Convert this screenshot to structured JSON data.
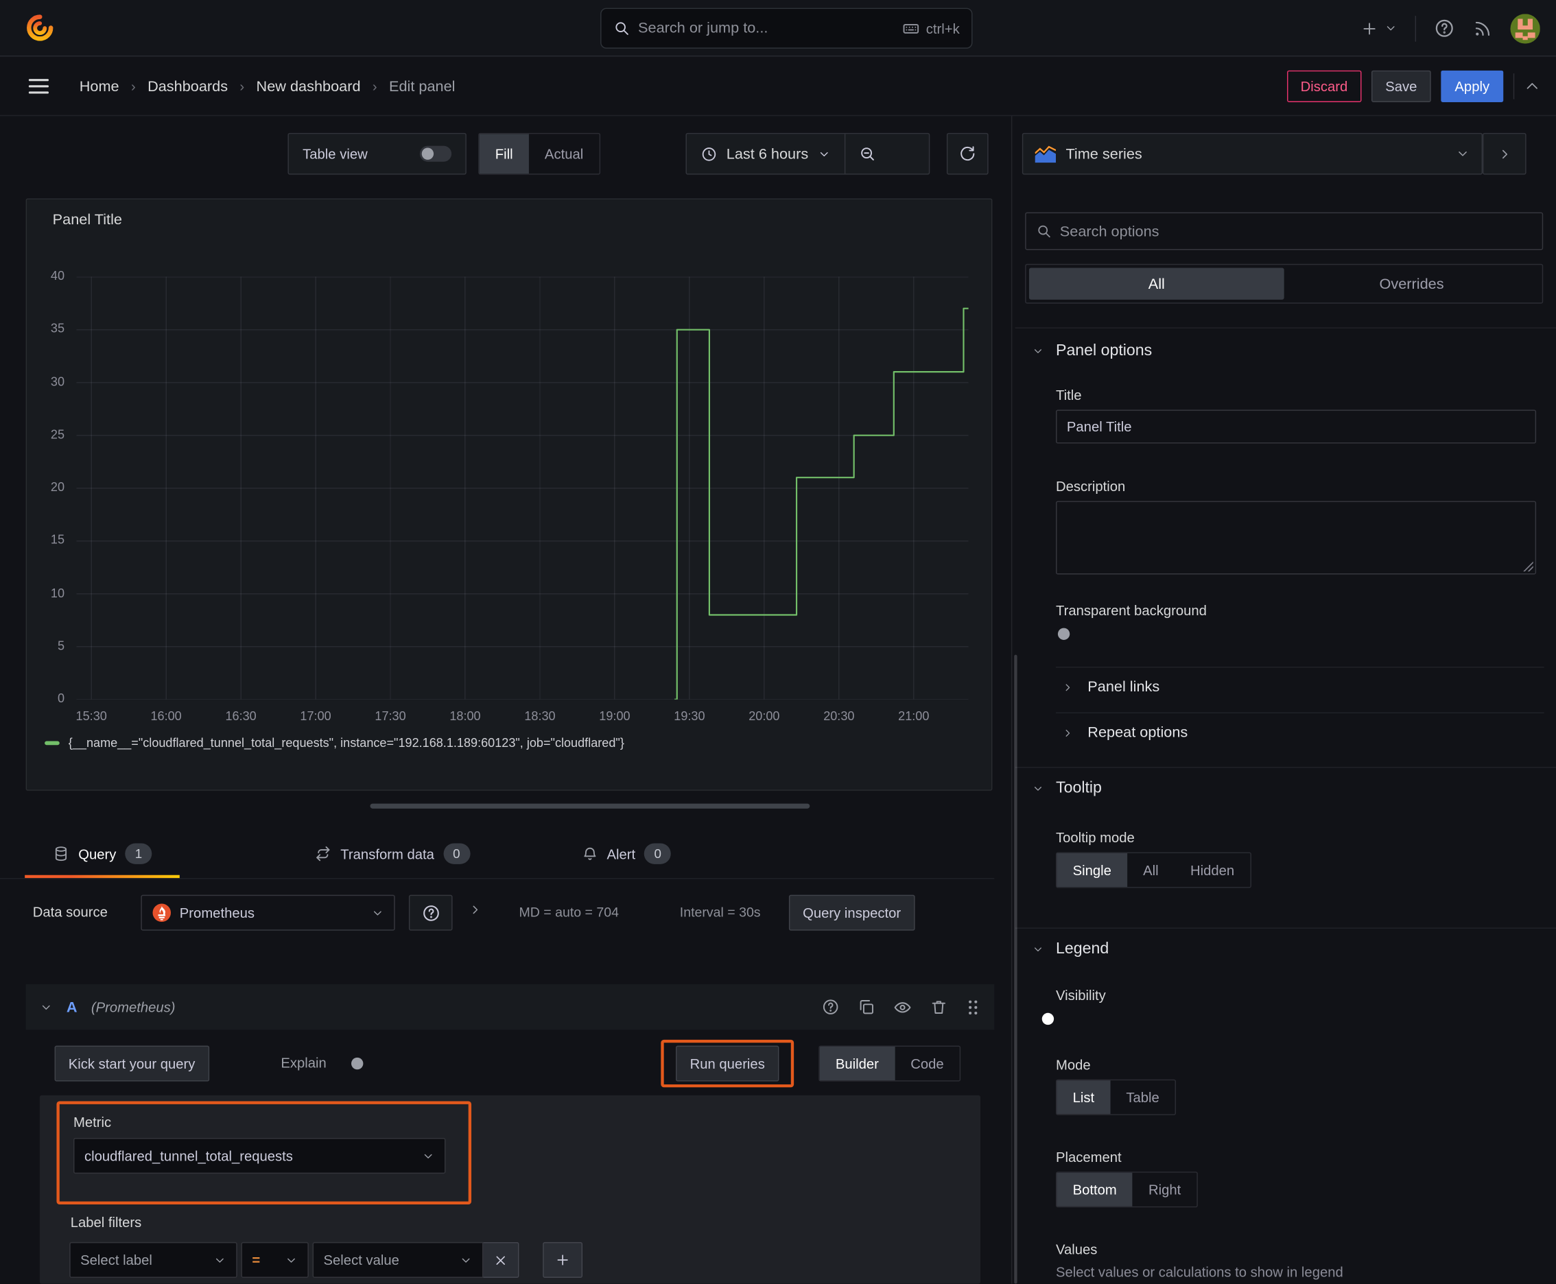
{
  "topbar": {
    "search_placeholder": "Search or jump to...",
    "shortcut": "ctrl+k"
  },
  "breadcrumb": {
    "items": [
      "Home",
      "Dashboards",
      "New dashboard",
      "Edit panel"
    ]
  },
  "nav_actions": {
    "discard": "Discard",
    "save": "Save",
    "apply": "Apply"
  },
  "viz_toolbar": {
    "table_view_label": "Table view",
    "fill_label": "Fill",
    "actual_label": "Actual",
    "time_range_label": "Last 6 hours"
  },
  "panel": {
    "title": "Panel Title",
    "legend_series": "{__name__=\"cloudflared_tunnel_total_requests\", instance=\"192.168.1.189:60123\", job=\"cloudflared\"}"
  },
  "chart_data": {
    "type": "line",
    "line_style": "step-after",
    "series_color": "#73bf69",
    "title": "Panel Title",
    "x_ticks": [
      "15:30",
      "16:00",
      "16:30",
      "17:00",
      "17:30",
      "18:00",
      "18:30",
      "19:00",
      "19:30",
      "20:00",
      "20:30",
      "21:00"
    ],
    "y_ticks": [
      0,
      5,
      10,
      15,
      20,
      25,
      30,
      35,
      40
    ],
    "ylim": [
      0,
      40
    ],
    "x_window": [
      "15:24",
      "21:22"
    ],
    "grid": true,
    "legend_position": "bottom",
    "series": [
      {
        "name": "{__name__=\"cloudflared_tunnel_total_requests\", instance=\"192.168.1.189:60123\", job=\"cloudflared\"}",
        "points": [
          [
            "19:24",
            0
          ],
          [
            "19:25",
            35
          ],
          [
            "19:38",
            8
          ],
          [
            "20:13",
            21
          ],
          [
            "20:36",
            25
          ],
          [
            "20:52",
            31
          ],
          [
            "21:20",
            37
          ]
        ]
      }
    ]
  },
  "query_tabs": {
    "query": "Query",
    "query_count": "1",
    "transform": "Transform data",
    "transform_count": "0",
    "alert": "Alert",
    "alert_count": "0"
  },
  "datasource_bar": {
    "label": "Data source",
    "value": "Prometheus",
    "max_data_points": "MD = auto = 704",
    "interval": "Interval = 30s",
    "inspector_label": "Query inspector"
  },
  "query_row": {
    "ref_id": "A",
    "datasource_hint": "(Prometheus)",
    "kick_start_label": "Kick start your query",
    "explain_label": "Explain",
    "run_queries_label": "Run queries",
    "builder_label": "Builder",
    "code_label": "Code"
  },
  "builder": {
    "metric_label": "Metric",
    "metric_value": "cloudflared_tunnel_total_requests",
    "label_filters_label": "Label filters",
    "select_label_placeholder": "Select label",
    "operator": "=",
    "select_value_placeholder": "Select value"
  },
  "options_pane": {
    "visualization": "Time series",
    "search_placeholder": "Search options",
    "filter_tabs": {
      "all": "All",
      "overrides": "Overrides"
    },
    "panel_options": {
      "header": "Panel options",
      "title_label": "Title",
      "title_value": "Panel Title",
      "description_label": "Description",
      "transparent_label": "Transparent background",
      "panel_links": "Panel links",
      "repeat_options": "Repeat options"
    },
    "tooltip": {
      "header": "Tooltip",
      "mode_label": "Tooltip mode",
      "modes": [
        "Single",
        "All",
        "Hidden"
      ],
      "selected_mode": "Single"
    },
    "legend": {
      "header": "Legend",
      "visibility_label": "Visibility",
      "mode_label": "Mode",
      "modes": [
        "List",
        "Table"
      ],
      "selected_mode": "List",
      "placement_label": "Placement",
      "placements": [
        "Bottom",
        "Right"
      ],
      "selected_placement": "Bottom",
      "values_label": "Values",
      "values_hint": "Select values or calculations to show in legend"
    }
  }
}
